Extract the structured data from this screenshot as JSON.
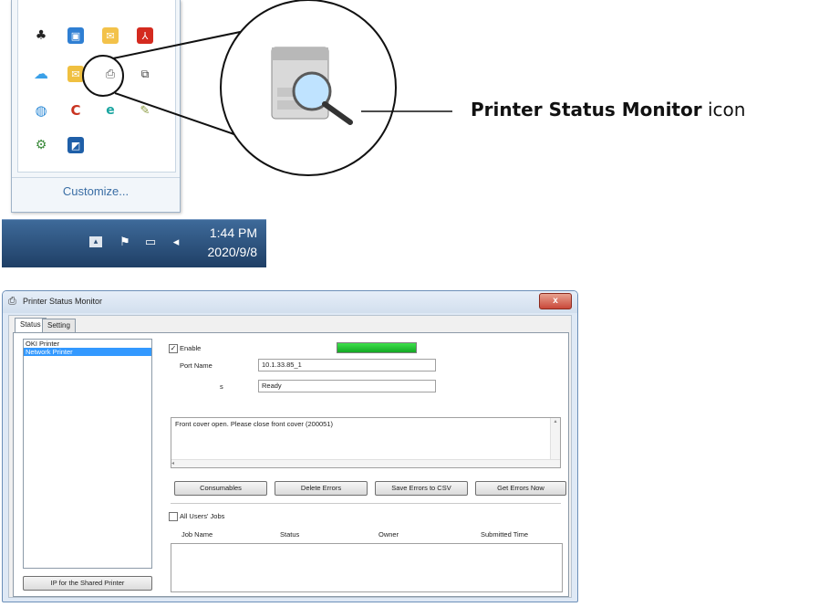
{
  "tray": {
    "customize_label": "Customize...",
    "icons": [
      "account-icon",
      "outlook-icon",
      "envelope-icon",
      "acrobat-icon",
      "cloud-icon",
      "mail-icon",
      "printer-status-monitor-icon",
      "copy-icon",
      "network-icon",
      "ccleaner-icon",
      "edge-icon",
      "tools-icon",
      "network-share-icon",
      "snip-icon"
    ]
  },
  "zoom": {
    "caption_bold": "Printer Status Monitor",
    "caption_rest": " icon"
  },
  "taskbar": {
    "time": "1:44 PM",
    "date": "2020/9/8"
  },
  "window": {
    "title": "Printer Status Monitor",
    "close_label": "x",
    "tabs": [
      {
        "label": "Status"
      },
      {
        "label": "Setting"
      }
    ],
    "printers": [
      "OKI Printer",
      "Network Printer"
    ],
    "selected_printer_index": 1,
    "enable_label": "Enable",
    "enable_checked": true,
    "port_name_label": "Port Name",
    "port_name_value": "10.1.33.85_1",
    "status_label": "s",
    "status_value": "Ready",
    "status_level_percent": 100,
    "status_color": "#1cb82c",
    "error_message": "Front cover open. Please close front cover (200051)",
    "buttons": {
      "consumables": "Consumables",
      "delete_errors": "Delete Errors",
      "save_errors": "Save Errors to CSV",
      "get_errors": "Get Errors Now"
    },
    "all_users_jobs_label": "All Users' Jobs",
    "all_users_jobs_checked": false,
    "jobs_columns": [
      "Job Name",
      "Status",
      "Owner",
      "Submitted Time"
    ],
    "shared_ip_button": "IP for the Shared Printer"
  }
}
